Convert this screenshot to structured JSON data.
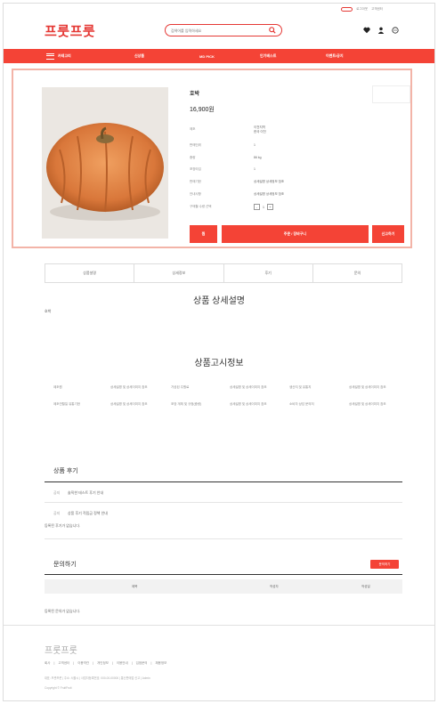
{
  "header": {
    "top_links": [
      "로그아웃",
      "고객센터"
    ],
    "logo_red": "프룻프룻",
    "search_placeholder": "검색어를 입력하세요"
  },
  "nav": {
    "menu_label": "카테고리",
    "items": [
      "신상품",
      "MD PICK",
      "인기베스트",
      "이벤트/공지"
    ]
  },
  "product": {
    "name": "호박",
    "price": "16,900원",
    "image_caption": "",
    "info": [
      {
        "label": "제조",
        "value": "이천지역\n한국 이천"
      },
      {
        "label": "판매단위",
        "value": "1"
      },
      {
        "label": "중량",
        "value": "86 kg"
      },
      {
        "label": "포장타입",
        "value": "1"
      },
      {
        "label": "판매기한",
        "value": "상세설명 상세정보 참조"
      },
      {
        "label": "안내사항",
        "value": "상세설명 상세정보 참조"
      },
      {
        "label": "구매할 수량 선택",
        "value": ""
      }
    ],
    "qty_minus": "-",
    "qty_value": "1",
    "qty_plus": "+",
    "buttons": {
      "wish": "찜",
      "order": "주문 / 장바구니",
      "report": "신고하기"
    }
  },
  "tabs": [
    "상품설명",
    "상세정보",
    "후기",
    "문의"
  ],
  "description": {
    "title": "상품 상세설명",
    "text": "호박"
  },
  "notice": {
    "title": "상품고시정보",
    "rows": [
      [
        {
          "label": "제조원",
          "value": "상세설명 및 상세이미지 참조"
        },
        {
          "label": "가공된 주원료",
          "value": "상세설명 및 상세이미지 참조"
        },
        {
          "label": "생산지 및 유통지",
          "value": "상세설명 및 상세이미지 참조"
        }
      ],
      [
        {
          "label": "제조연월일 유통기한",
          "value": "상세설명 및 상세이미지 참조"
        },
        {
          "label": "포장 개체 및 규정(중량)",
          "value": "상세설명 및 상세이미지 참조"
        },
        {
          "label": "소비자 상담 문의처",
          "value": "상세설명 및 상세이미지 참조"
        }
      ]
    ]
  },
  "reviews": {
    "title": "상품 후기",
    "notice1_tag": "공지",
    "notice1": "솔직한 테스트 후기 안내",
    "notice2_tag": "공지",
    "notice2": "상품 후기 적립금 정책 안내",
    "empty": "등록된 후기가 없습니다."
  },
  "inquiry": {
    "title": "문의하기",
    "button": "문의하기",
    "col_title": "제목",
    "col_author": "작성자",
    "col_date": "작성일",
    "empty": "등록된 문의가 없습니다."
  },
  "footer": {
    "logo": "프룻프룻",
    "links": [
      "회사",
      "고객센터",
      "이용약관",
      "개인정보",
      "이용안내",
      "입점문의",
      "채용정보"
    ],
    "info": "대표: 프룻프룻  |  주소: 서울시  |  사업자등록번호: 000-00-00000  |  통신판매업 신고  |  Admin",
    "copyright": "Copyright © FruitFruit"
  },
  "colors": {
    "accent": "#f44336",
    "highlight_border": "#f3b4a8",
    "logo_green": "#3aa847"
  }
}
